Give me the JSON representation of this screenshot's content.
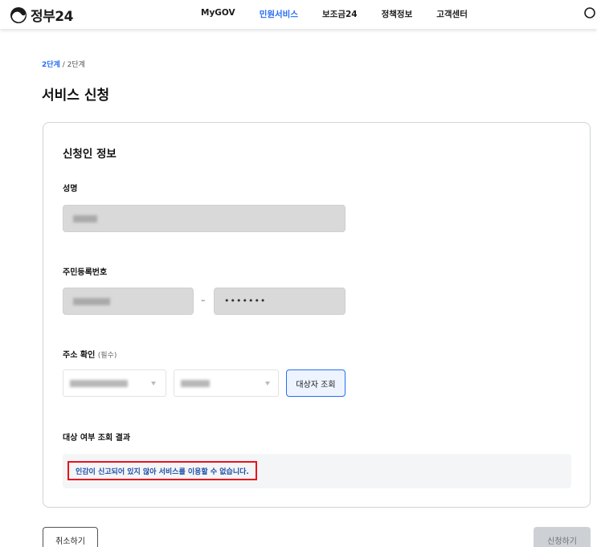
{
  "header": {
    "logo_text": "정부24",
    "nav": [
      "MyGOV",
      "민원서비스",
      "보조금24",
      "정책정보",
      "고객센터"
    ],
    "active_nav_index": 1
  },
  "breadcrumb": {
    "current": "2단계",
    "separator": " / ",
    "total": "2단계"
  },
  "page_title": "서비스 신청",
  "applicant": {
    "section_title": "신청인 정보",
    "name_label": "성명",
    "rrn_label": "주민등록번호",
    "rrn_dash": "–",
    "rrn_back_masked": "•••••••",
    "address_label": "주소 확인",
    "address_required": "(필수)",
    "search_button": "대상자 조회"
  },
  "result": {
    "title": "대상 여부 조회 결과",
    "message": "인감이 신고되어 있지 않아 서비스를 이용할 수 없습니다."
  },
  "footer": {
    "cancel_label": "취소하기",
    "submit_label": "신청하기"
  },
  "colors": {
    "accent": "#256ef4",
    "error_border": "#e8131e",
    "result_text": "#1f4fa8"
  }
}
